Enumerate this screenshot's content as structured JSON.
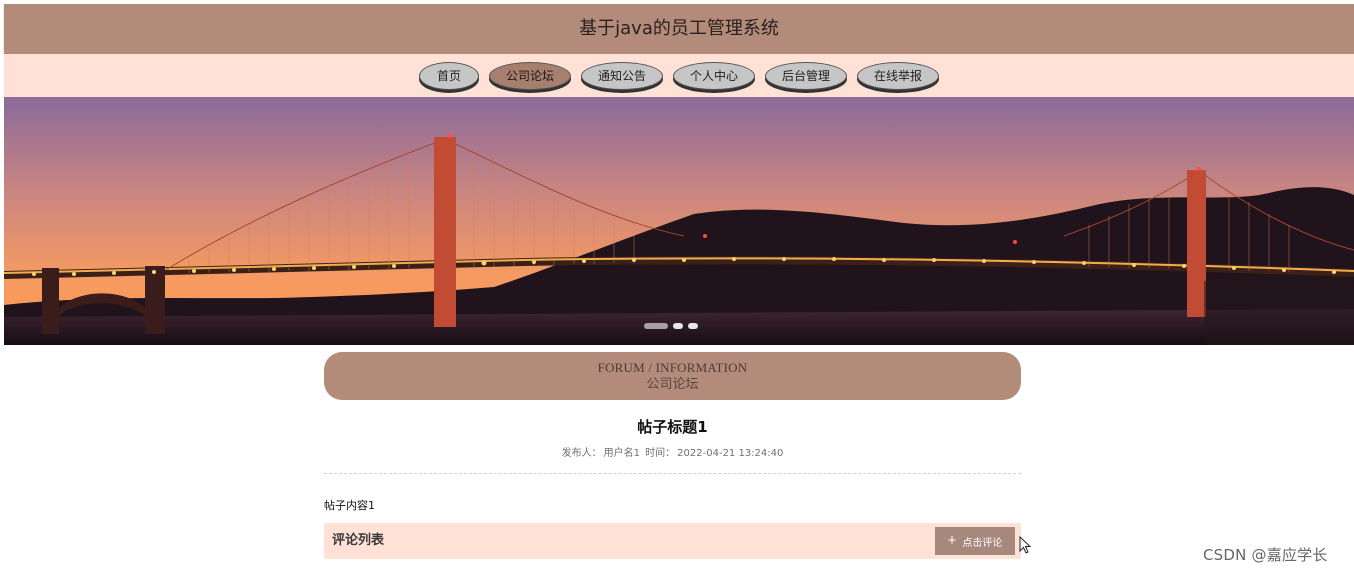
{
  "app": {
    "title": "基于java的员工管理系统"
  },
  "nav": {
    "items": [
      {
        "label": "首页",
        "active": false
      },
      {
        "label": "公司论坛",
        "active": true
      },
      {
        "label": "通知公告",
        "active": false
      },
      {
        "label": "个人中心",
        "active": false
      },
      {
        "label": "后台管理",
        "active": false
      },
      {
        "label": "在线举报",
        "active": false
      }
    ]
  },
  "banner": {
    "active_slide": 1,
    "slide_count": 3
  },
  "section": {
    "english_title": "FORUM / INFORMATION",
    "chinese_title": "公司论坛"
  },
  "post": {
    "title": "帖子标题1",
    "publisher_label": "发布人：",
    "publisher_name": "用户名1",
    "time_label": "时间：",
    "time_value": "2022-04-21 13:24:40",
    "content": "帖子内容1"
  },
  "comments": {
    "title": "评论列表",
    "button_label": "点击评论"
  },
  "watermark": {
    "text": "CSDN @嘉应学长"
  },
  "colors": {
    "header": "#b38b7b",
    "nav_background": "#ffe1d6",
    "active_nav": "#a67f6f",
    "comment_bar": "#ffe1d6",
    "comment_button": "#a6887c"
  },
  "icons": {
    "plus": "plus-icon",
    "cursor": "mouse-cursor-icon"
  }
}
